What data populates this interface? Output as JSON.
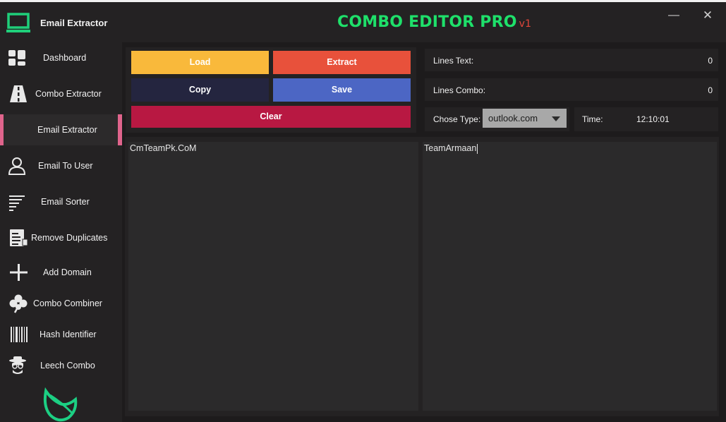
{
  "window": {
    "title": "Email Extractor",
    "brand": "COMBO EDITOR PRO",
    "version": "v1",
    "minimize_glyph": "—",
    "close_glyph": "✕",
    "brand_color": "#1ee06a",
    "version_color": "#e2473b"
  },
  "sidebar": {
    "items": [
      {
        "label": "Dashboard",
        "icon": "dashboard-icon"
      },
      {
        "label": "Combo Extractor",
        "icon": "road-icon"
      },
      {
        "label": "Email Extractor",
        "icon": "",
        "active": true
      },
      {
        "label": "Email To User",
        "icon": "user-icon"
      },
      {
        "label": "Email Sorter",
        "icon": "sort-lines-icon"
      },
      {
        "label": "Remove Duplicates",
        "icon": "document-list-icon"
      },
      {
        "label": "Add Domain",
        "icon": "plus-icon"
      },
      {
        "label": "Combo Combiner",
        "icon": "clover-icon"
      },
      {
        "label": "Hash Identifier",
        "icon": "barcode-icon"
      },
      {
        "label": "Leech Combo",
        "icon": "spy-icon"
      }
    ],
    "active_color": "#e0648c"
  },
  "buttons": {
    "load": "Load",
    "extract": "Extract",
    "copy": "Copy",
    "save": "Save",
    "clear": "Clear"
  },
  "info": {
    "lines_text_label": "Lines Text:",
    "lines_text_value": "0",
    "lines_combo_label": "Lines Combo:",
    "lines_combo_value": "0",
    "type_label": "Chose Type:",
    "type_value": "outlook.com",
    "time_label": "Time:",
    "time_value": "12:10:01"
  },
  "editors": {
    "left_text": "CmTeamPk.CoM",
    "right_text": "TeamArmaan"
  }
}
